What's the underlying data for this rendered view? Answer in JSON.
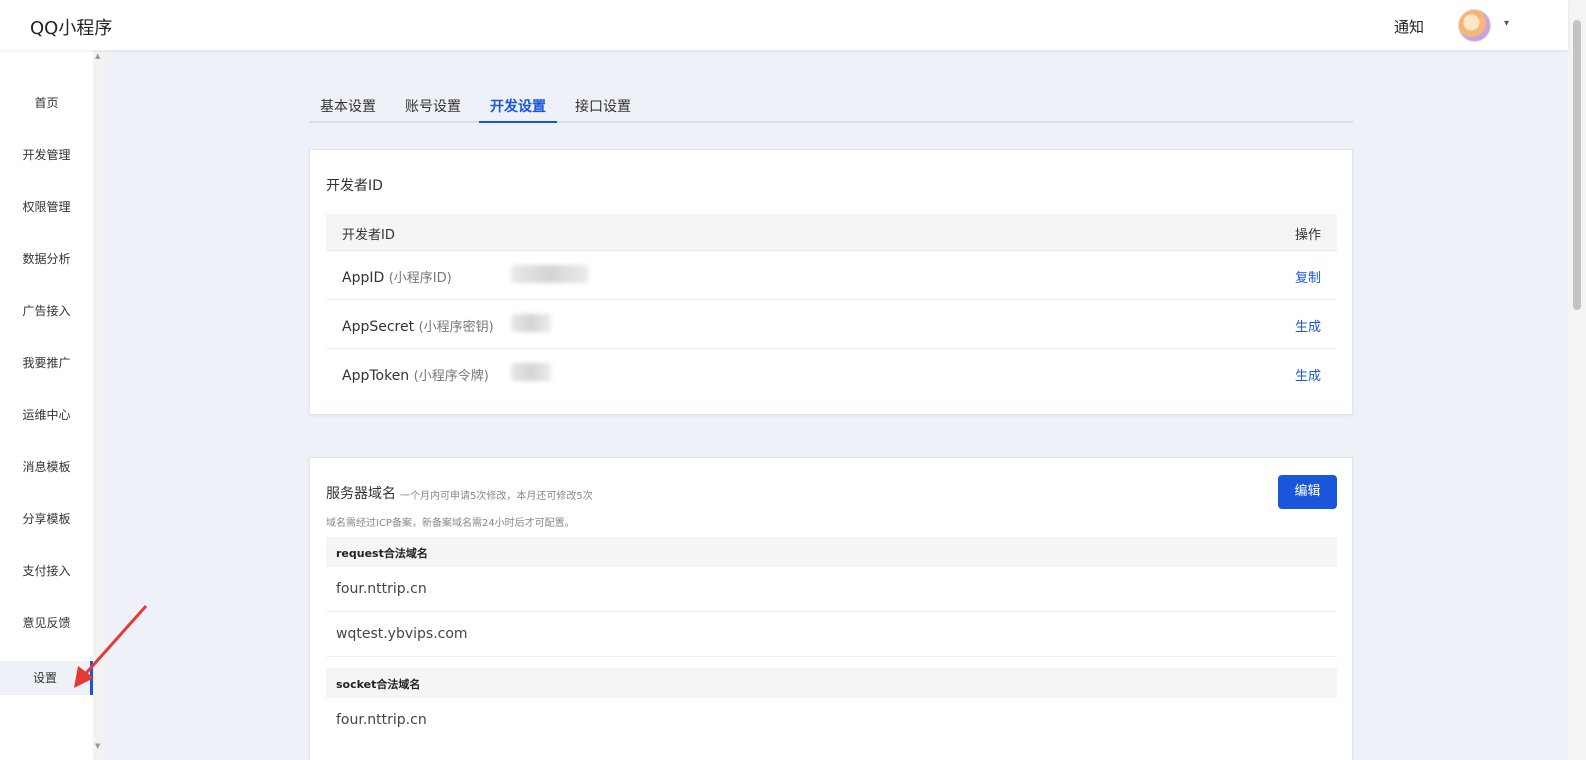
{
  "header": {
    "app_title": "QQ小程序",
    "notice_label": "通知",
    "avatar_caret": "▾"
  },
  "sidebar": {
    "items": [
      {
        "label": "首页"
      },
      {
        "label": "开发管理"
      },
      {
        "label": "权限管理"
      },
      {
        "label": "数据分析"
      },
      {
        "label": "广告接入"
      },
      {
        "label": "我要推广"
      },
      {
        "label": "运维中心"
      },
      {
        "label": "消息模板"
      },
      {
        "label": "分享模板"
      },
      {
        "label": "支付接入"
      },
      {
        "label": "意见反馈"
      },
      {
        "label": "设置"
      }
    ],
    "active_index": 11
  },
  "tabs": [
    {
      "label": "基本设置"
    },
    {
      "label": "账号设置"
    },
    {
      "label": "开发设置",
      "active": true
    },
    {
      "label": "接口设置"
    }
  ],
  "developer_card": {
    "title": "开发者ID",
    "header_col1": "开发者ID",
    "header_col2": "操作",
    "rows": [
      {
        "name": "AppID",
        "sub": "(小程序ID)",
        "action": "复制"
      },
      {
        "name": "AppSecret",
        "sub": "(小程序密钥)",
        "action": "生成"
      },
      {
        "name": "AppToken",
        "sub": "(小程序令牌)",
        "action": "生成"
      }
    ]
  },
  "server_card": {
    "title": "服务器域名",
    "hint": "一个月内可申请5次修改，本月还可修改5次",
    "note": "域名需经过ICP备案，新备案域名需24小时后才可配置。",
    "edit_label": "编辑",
    "request_label": "request合法域名",
    "request_domains": [
      "four.nttrip.cn",
      "wqtest.ybvips.com"
    ],
    "socket_label": "socket合法域名",
    "socket_domains": [
      "four.nttrip.cn"
    ]
  },
  "colors": {
    "accent": "#1a56db",
    "annotation_arrow": "#e53935",
    "page_bg": "#eef1f8"
  }
}
